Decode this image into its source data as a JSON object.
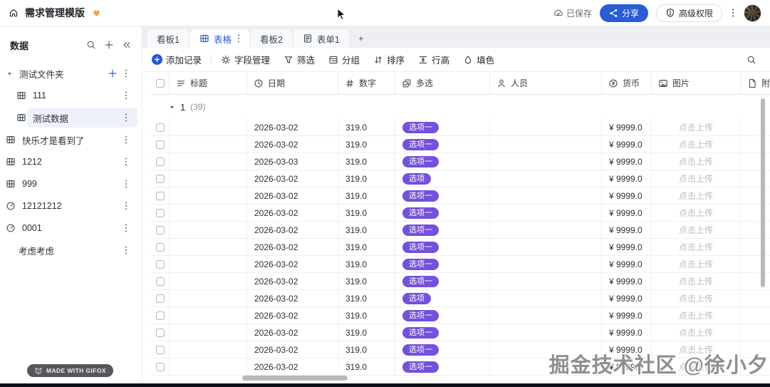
{
  "topbar": {
    "title": "需求管理模版",
    "title_badge_icon": "heart-icon",
    "saved_status": "已保存",
    "share_label": "分享",
    "permissions_label": "高级权限"
  },
  "sidebar": {
    "header": "数据",
    "header_icons": [
      "search-icon",
      "plus-icon",
      "collapse-icon"
    ],
    "items": [
      {
        "label": "测试文件夹",
        "kind": "folder",
        "icon": "caret-down-icon",
        "level": 0,
        "selected": false,
        "actions": [
          "add",
          "menu"
        ]
      },
      {
        "label": "111",
        "kind": "table",
        "icon": "table-grid-icon",
        "level": 1,
        "selected": false,
        "actions": [
          "menu"
        ]
      },
      {
        "label": "测试数据",
        "kind": "table",
        "icon": "table-grid-icon",
        "level": 1,
        "selected": true,
        "actions": [
          "menu"
        ]
      },
      {
        "label": "快乐才是看到了",
        "kind": "table",
        "icon": "table-grid-icon",
        "level": 0,
        "selected": false,
        "actions": [
          "menu"
        ]
      },
      {
        "label": "1212",
        "kind": "table",
        "icon": "table-grid-icon",
        "level": 0,
        "selected": false,
        "actions": [
          "menu"
        ]
      },
      {
        "label": "999",
        "kind": "table",
        "icon": "table-grid-icon",
        "level": 0,
        "selected": false,
        "actions": [
          "menu"
        ]
      },
      {
        "label": "12121212",
        "kind": "dashboard",
        "icon": "gauge-icon",
        "level": 0,
        "selected": false,
        "actions": [
          "menu"
        ]
      },
      {
        "label": "0001",
        "kind": "dashboard",
        "icon": "gauge-icon",
        "level": 0,
        "selected": false,
        "actions": [
          "menu"
        ]
      },
      {
        "label": "考虑考虑",
        "kind": "plain",
        "icon": "",
        "level": 0,
        "selected": false,
        "actions": [
          "menu"
        ]
      }
    ]
  },
  "tabs": [
    {
      "label": "看板1",
      "active": false,
      "icon": "",
      "menu": false
    },
    {
      "label": "表格",
      "active": true,
      "icon": "table-grid-icon",
      "menu": true
    },
    {
      "label": "看板2",
      "active": false,
      "icon": "",
      "menu": false
    },
    {
      "label": "表单1",
      "active": false,
      "icon": "form-icon",
      "menu": false
    }
  ],
  "tab_add_label": "+",
  "toolbar": {
    "add_record": "添加记录",
    "field_manage": "字段管理",
    "filter": "筛选",
    "group": "分组",
    "sort": "排序",
    "row_height": "行高",
    "fill_color": "填色"
  },
  "table": {
    "columns": [
      {
        "label": "标题",
        "icon": "title-lines-icon"
      },
      {
        "label": "日期",
        "icon": "clock-icon"
      },
      {
        "label": "数字",
        "icon": "hash-icon"
      },
      {
        "label": "多选",
        "icon": "multiselect-icon"
      },
      {
        "label": "人员",
        "icon": "person-icon"
      },
      {
        "label": "货币",
        "icon": "currency-icon"
      },
      {
        "label": "图片",
        "icon": "image-icon"
      },
      {
        "label": "附件",
        "icon": "attachment-icon"
      }
    ],
    "group": {
      "name": "1",
      "count": "(39)"
    },
    "upload_placeholder": "点击上传",
    "rows": [
      {
        "title": "",
        "date": "2026-03-02",
        "number": "319.0",
        "tag": "选项一",
        "person": "",
        "currency": "¥ 9999.0"
      },
      {
        "title": "",
        "date": "2026-03-02",
        "number": "319.0",
        "tag": "选项一",
        "person": "",
        "currency": "¥ 9999.0"
      },
      {
        "title": "",
        "date": "2026-03-03",
        "number": "319.0",
        "tag": "选项一",
        "person": "",
        "currency": "¥ 9999.0"
      },
      {
        "title": "",
        "date": "2026-03-02",
        "number": "319.0",
        "tag": "选项",
        "person": "",
        "currency": "¥ 9999.0"
      },
      {
        "title": "",
        "date": "2026-03-02",
        "number": "319.0",
        "tag": "选项一",
        "person": "",
        "currency": "¥ 9999.0"
      },
      {
        "title": "",
        "date": "2026-03-02",
        "number": "319.0",
        "tag": "选项一",
        "person": "",
        "currency": "¥ 9999.0"
      },
      {
        "title": "",
        "date": "2026-03-02",
        "number": "319.0",
        "tag": "选项一",
        "person": "",
        "currency": "¥ 9999.0"
      },
      {
        "title": "",
        "date": "2026-03-02",
        "number": "319.0",
        "tag": "选项一",
        "person": "",
        "currency": "¥ 9999.0"
      },
      {
        "title": "",
        "date": "2026-03-02",
        "number": "319.0",
        "tag": "选项一",
        "person": "",
        "currency": "¥ 9999.0"
      },
      {
        "title": "",
        "date": "2026-03-02",
        "number": "319.0",
        "tag": "选项一",
        "person": "",
        "currency": "¥ 9999.0"
      },
      {
        "title": "",
        "date": "2026-03-02",
        "number": "319.0",
        "tag": "选项",
        "person": "",
        "currency": "¥ 9999.0"
      },
      {
        "title": "",
        "date": "2026-03-02",
        "number": "319.0",
        "tag": "选项一",
        "person": "",
        "currency": "¥ 9999.0"
      },
      {
        "title": "",
        "date": "2026-03-02",
        "number": "319.0",
        "tag": "选项一",
        "person": "",
        "currency": "¥ 9999.0"
      },
      {
        "title": "",
        "date": "2026-03-02",
        "number": "319.0",
        "tag": "选项一",
        "person": "",
        "currency": "¥ 9999.0"
      },
      {
        "title": "",
        "date": "2026-03-02",
        "number": "319.0",
        "tag": "选项一",
        "person": "",
        "currency": "¥ 9999.0"
      }
    ]
  },
  "watermark": "掘金技术社区 @徐小夕",
  "made_with_badge": "MADE WITH GIFOX",
  "colors": {
    "accent_blue": "#2a5cd7",
    "active_tab_blue": "#2e5bd6",
    "tag_purple": "#7450dc",
    "tabbar_bg": "#edeff2",
    "selected_item_bg": "#edf1f9",
    "upload_text": "#b9bdc3"
  }
}
